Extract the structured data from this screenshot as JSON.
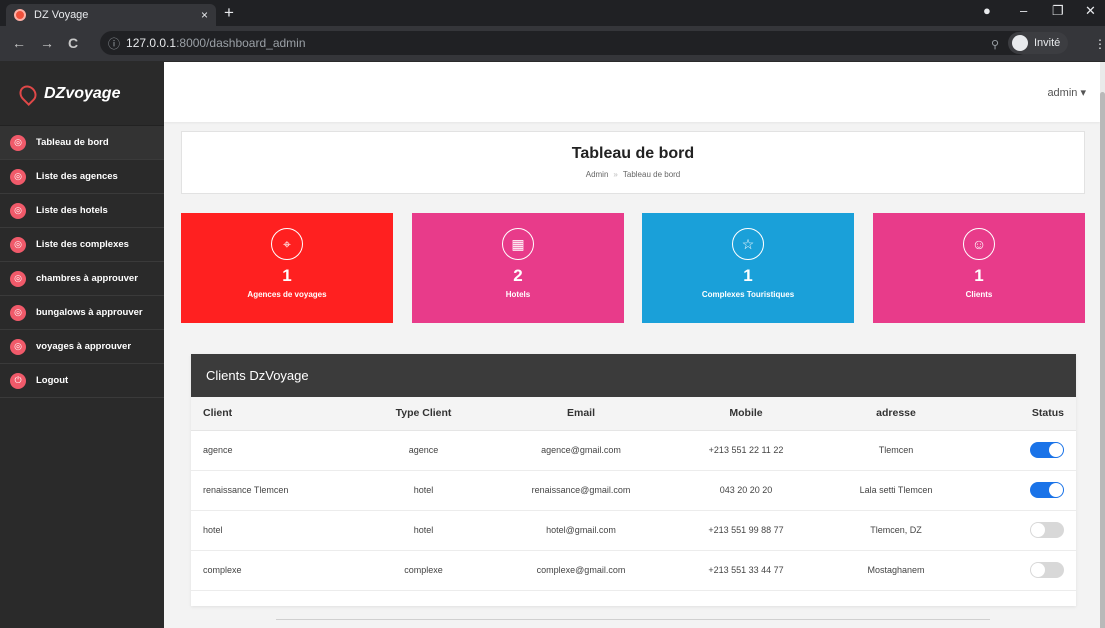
{
  "browser": {
    "tab_title": "DZ Voyage",
    "tab_close": "×",
    "new_tab": "+",
    "url_host": "127.0.0.1",
    "url_path": ":8000/dashboard_admin",
    "profile_label": "Invité",
    "icons": [
      "back-icon",
      "forward-icon",
      "reload-icon",
      "info-icon",
      "zoom-icon",
      "profile-icon",
      "kebab-menu-icon"
    ]
  },
  "brand": {
    "name": "DZvoyage"
  },
  "sidebar": {
    "items": [
      {
        "label": "Tableau de bord",
        "icon": "dashboard-icon",
        "active": true
      },
      {
        "label": "Liste des agences",
        "icon": "agency-icon"
      },
      {
        "label": "Liste des hotels",
        "icon": "hotel-icon"
      },
      {
        "label": "Liste des complexes",
        "icon": "complex-icon"
      },
      {
        "label": "chambres à approuver",
        "icon": "room-icon"
      },
      {
        "label": "bungalows à approuver",
        "icon": "bungalow-icon"
      },
      {
        "label": "voyages à approuver",
        "icon": "trip-icon"
      },
      {
        "label": "Logout",
        "icon": "power-icon"
      }
    ]
  },
  "topbar": {
    "user": "admin"
  },
  "header": {
    "title": "Tableau de bord",
    "breadcrumb": [
      "Admin",
      "Tableau de bord"
    ]
  },
  "stats": [
    {
      "value": "1",
      "label": "Agences de voyages",
      "color": "#ff2020",
      "icon": "map-icon"
    },
    {
      "value": "2",
      "label": "Hotels",
      "color": "#e83b8a",
      "icon": "hotel-icon"
    },
    {
      "value": "1",
      "label": "Complexes Touristiques",
      "color": "#1aa0d9",
      "icon": "star-icon"
    },
    {
      "value": "1",
      "label": "Clients",
      "color": "#e83b8a",
      "icon": "client-icon"
    }
  ],
  "table": {
    "title": "Clients DzVoyage",
    "columns": [
      "Client",
      "Type Client",
      "Email",
      "Mobile",
      "adresse",
      "Status"
    ],
    "rows": [
      {
        "client": "agence",
        "type": "agence",
        "email": "agence@gmail.com",
        "mobile": "+213 551 22 11 22",
        "address": "Tlemcen",
        "status": true
      },
      {
        "client": "renaissance Tlemcen",
        "type": "hotel",
        "email": "renaissance@gmail.com",
        "mobile": "043 20 20 20",
        "address": "Lala setti Tlemcen",
        "status": true
      },
      {
        "client": "hotel",
        "type": "hotel",
        "email": "hotel@gmail.com",
        "mobile": "+213 551 99 88 77",
        "address": "Tlemcen, DZ",
        "status": false
      },
      {
        "client": "complexe",
        "type": "complexe",
        "email": "complexe@gmail.com",
        "mobile": "+213 551 33 44 77",
        "address": "Mostaghanem",
        "status": false
      }
    ]
  }
}
